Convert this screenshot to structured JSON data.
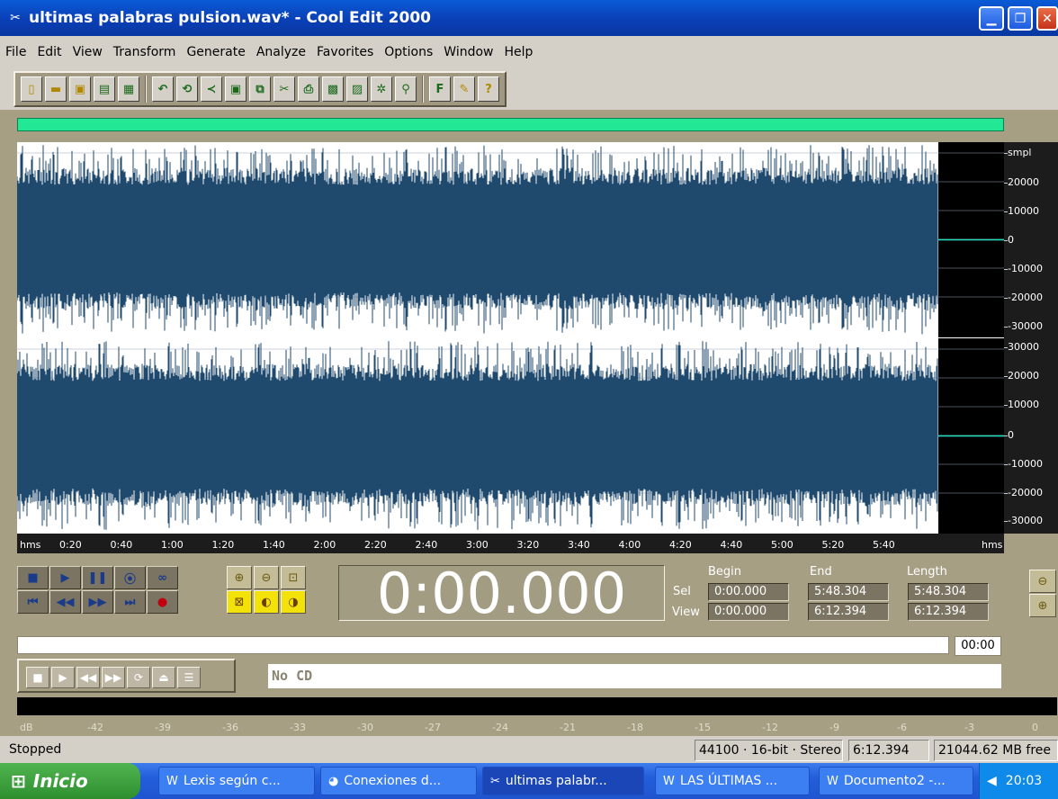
{
  "window": {
    "title": "ultimas palabras pulsion.wav* - Cool Edit 2000"
  },
  "menu": [
    "File",
    "Edit",
    "View",
    "Transform",
    "Generate",
    "Analyze",
    "Favorites",
    "Options",
    "Window",
    "Help"
  ],
  "toolbar_groups": [
    [
      {
        "icon": "new-file-icon",
        "g": "▯",
        "y": true
      },
      {
        "icon": "open-folder-icon",
        "g": "▬",
        "y": true
      },
      {
        "icon": "save-icon",
        "g": "▣",
        "y": true
      },
      {
        "icon": "save-as-icon",
        "g": "▤",
        "y": false
      },
      {
        "icon": "save-all-icon",
        "g": "▦",
        "y": false
      }
    ],
    [
      {
        "icon": "undo-icon",
        "g": "↶",
        "y": false
      },
      {
        "icon": "loop-icon",
        "g": "⟲",
        "y": false
      },
      {
        "icon": "trim-icon",
        "g": "≺",
        "y": false
      },
      {
        "icon": "select-icon",
        "g": "▣",
        "y": false
      },
      {
        "icon": "copy-icon",
        "g": "⧉",
        "y": false
      },
      {
        "icon": "cut-icon",
        "g": "✂",
        "y": false
      },
      {
        "icon": "paste-icon",
        "g": "⎙",
        "y": false
      },
      {
        "icon": "paste-new-icon",
        "g": "▩",
        "y": false
      },
      {
        "icon": "mix-paste-icon",
        "g": "▨",
        "y": false
      },
      {
        "icon": "effects-icon",
        "g": "✲",
        "y": false
      },
      {
        "icon": "favorites-icon",
        "g": "⚲",
        "y": false
      }
    ],
    [
      {
        "icon": "f-icon",
        "g": "F",
        "y": false
      },
      {
        "icon": "script-icon",
        "g": "✎",
        "y": true
      },
      {
        "icon": "help-icon",
        "g": "?",
        "y": true
      }
    ]
  ],
  "amplitude_scale": {
    "channel1": [
      "smpl",
      "20000",
      "10000",
      "0",
      "-10000",
      "-20000",
      "-30000"
    ],
    "channel2": [
      "30000",
      "20000",
      "10000",
      "0",
      "-10000",
      "-20000",
      "-30000"
    ]
  },
  "timeline": {
    "start_label": "hms",
    "end_label": "hms",
    "ticks": [
      "0:20",
      "0:40",
      "1:00",
      "1:20",
      "1:40",
      "2:00",
      "2:20",
      "2:40",
      "3:00",
      "3:20",
      "3:40",
      "4:00",
      "4:20",
      "4:40",
      "5:00",
      "5:20",
      "5:40"
    ]
  },
  "time_display": "0:00.000",
  "selection": {
    "headers": [
      "Begin",
      "End",
      "Length"
    ],
    "sel_label": "Sel",
    "view_label": "View",
    "sel": [
      "0:00.000",
      "5:48.304",
      "5:48.304"
    ],
    "view": [
      "0:00.000",
      "6:12.394",
      "6:12.394"
    ]
  },
  "progress_time": "00:00",
  "cd": {
    "status": "No CD"
  },
  "meter_scale": [
    "dB",
    "-42",
    "-39",
    "-36",
    "-33",
    "-30",
    "-27",
    "-24",
    "-21",
    "-18",
    "-15",
    "-12",
    "-9",
    "-6",
    "-3",
    "0"
  ],
  "status": {
    "text": "Stopped",
    "format": "44100 · 16-bit · Stereo",
    "length": "6:12.394",
    "free": "21044.62 MB free"
  },
  "taskbar": {
    "start": "Inicio",
    "tasks": [
      {
        "label": "Lexis según c...",
        "icon": "word-icon"
      },
      {
        "label": "Conexiones d...",
        "icon": "network-icon"
      },
      {
        "label": "ultimas palabr...",
        "icon": "cool-edit-icon",
        "active": true
      },
      {
        "label": "LAS ÚLTIMAS ...",
        "icon": "word-icon"
      },
      {
        "label": "Documento2 -...",
        "icon": "word-icon"
      }
    ],
    "clock": "20:03"
  }
}
